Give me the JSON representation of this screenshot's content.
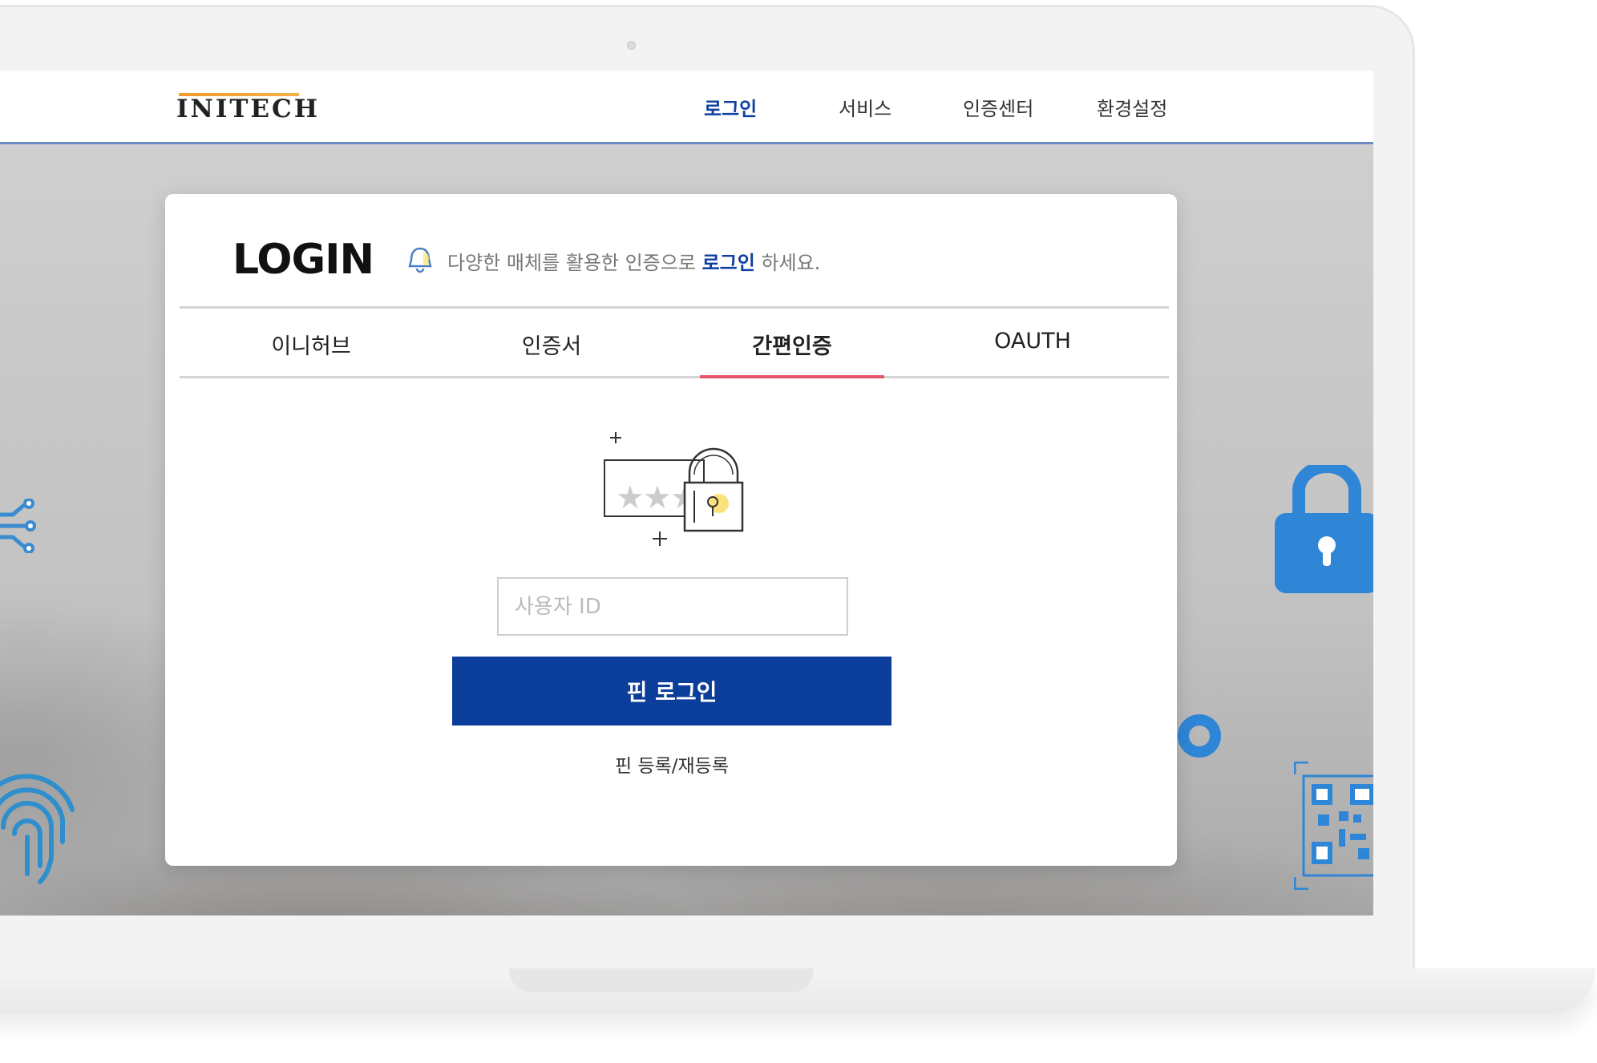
{
  "header": {
    "logo_text": "INITECH",
    "nav": [
      "로그인",
      "서비스",
      "인증센터",
      "환경설정"
    ],
    "active_nav": "로그인"
  },
  "login": {
    "title": "LOGIN",
    "subtitle_prefix": "다양한 매체를 활용한 인증으로 ",
    "subtitle_highlight": "로그인",
    "subtitle_suffix": " 하세요.",
    "tabs": [
      "이니허브",
      "인증서",
      "간편인증",
      "OAUTH"
    ],
    "active_tab": "간편인증",
    "user_id_placeholder": "사용자 ID",
    "user_id_value": "",
    "pin_login_label": "핀 로그인",
    "pin_register_label": "핀 등록/재등록"
  },
  "colors": {
    "brand_blue": "#0b3d9a",
    "active_tab_indicator": "#e5566d",
    "header_border": "#6d8cc3",
    "decor_blue": "#2f86d6"
  },
  "icons": [
    "bell-icon",
    "pin-lock-illustration",
    "padlock-icon",
    "fingerprint-icon",
    "qr-code-icon",
    "network-nodes-icon"
  ]
}
